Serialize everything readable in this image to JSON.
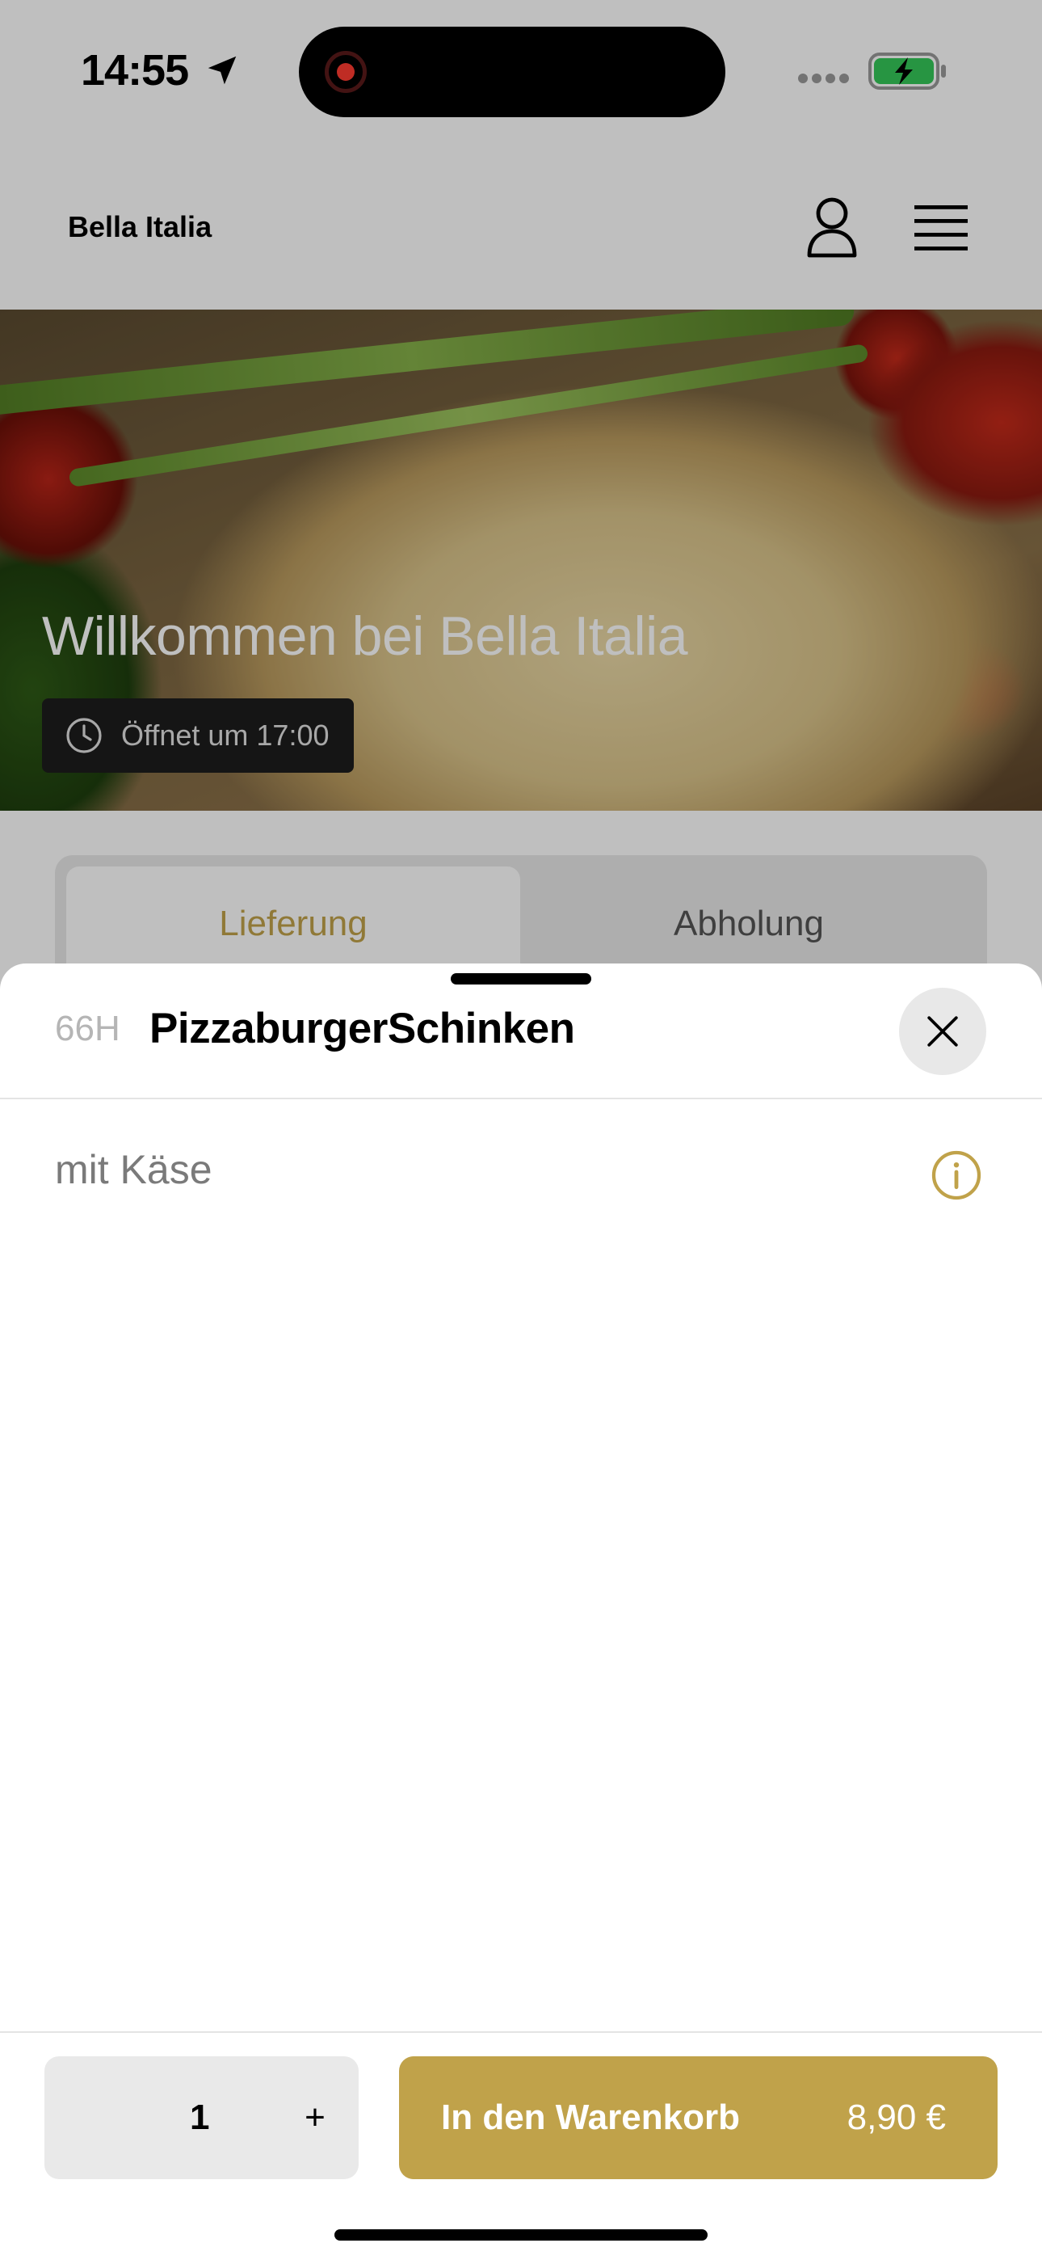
{
  "status_bar": {
    "time": "14:55"
  },
  "header": {
    "brand": "Bella Italia",
    "icons": [
      "user-icon",
      "menu-icon"
    ]
  },
  "hero": {
    "title": "Willkommen bei Bella Italia",
    "opening_badge": "Öffnet um 17:00"
  },
  "mode_tabs": {
    "delivery": "Lieferung",
    "pickup": "Abholung",
    "selected": "Lieferung"
  },
  "product_sheet": {
    "item_code": "66H",
    "item_title": "PizzaburgerSchinken",
    "description": "mit Käse"
  },
  "footer": {
    "quantity": "1",
    "increment_label": "+",
    "add_to_cart_label": "In den Warenkorb",
    "price": "8,90 €"
  },
  "colors": {
    "accent": "#c0a24a",
    "battery_green": "#34c759",
    "record_red": "#ff3b30"
  }
}
